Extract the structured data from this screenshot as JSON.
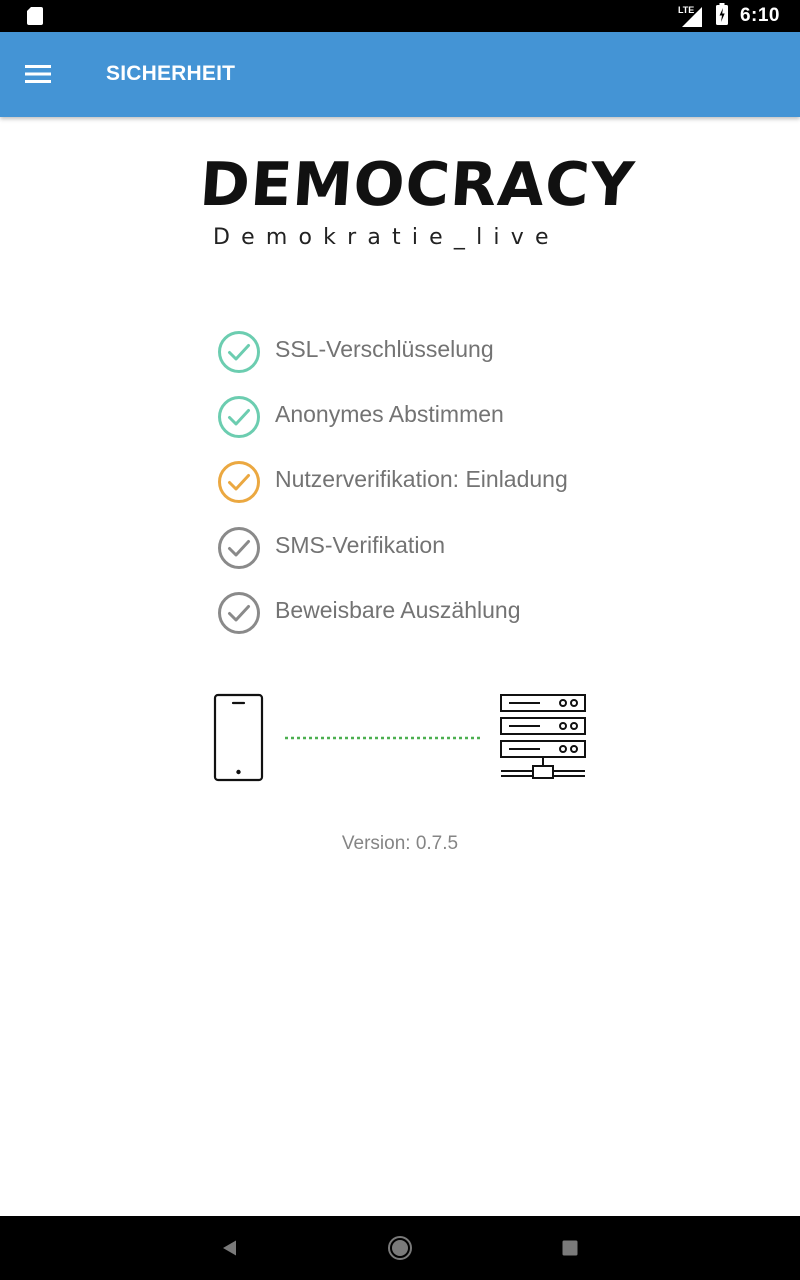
{
  "status_bar": {
    "network_label": "LTE",
    "time": "6:10"
  },
  "app_bar": {
    "menu_icon": "hamburger-menu-icon",
    "title": "SICHERHEIT",
    "background_color": "#4494d5"
  },
  "logo": {
    "title": "DEMOCRACY",
    "subtitle": "Demokratie_live"
  },
  "security_items": [
    {
      "label": "SSL-Verschlüsselung",
      "icon": "check-circle-icon",
      "status": "active",
      "color": "#6ccdb0"
    },
    {
      "label": "Anonymes Abstimmen",
      "icon": "check-circle-icon",
      "status": "active",
      "color": "#6ccdb0"
    },
    {
      "label": "Nutzerverifikation: Einladung",
      "icon": "check-circle-icon",
      "status": "partial",
      "color": "#eba841"
    },
    {
      "label": "SMS-Verifikation",
      "icon": "check-circle-icon",
      "status": "inactive",
      "color": "#8a8a8a"
    },
    {
      "label": "Beweisbare Auszählung",
      "icon": "check-circle-icon",
      "status": "inactive",
      "color": "#8a8a8a"
    }
  ],
  "connection": {
    "client_icon": "smartphone-icon",
    "server_icon": "server-icon",
    "link_color": "#4caf50"
  },
  "version": "Version: 0.7.5",
  "nav_bar": {
    "back_icon": "back-triangle-icon",
    "home_icon": "home-circle-icon",
    "recents_icon": "recents-square-icon"
  }
}
